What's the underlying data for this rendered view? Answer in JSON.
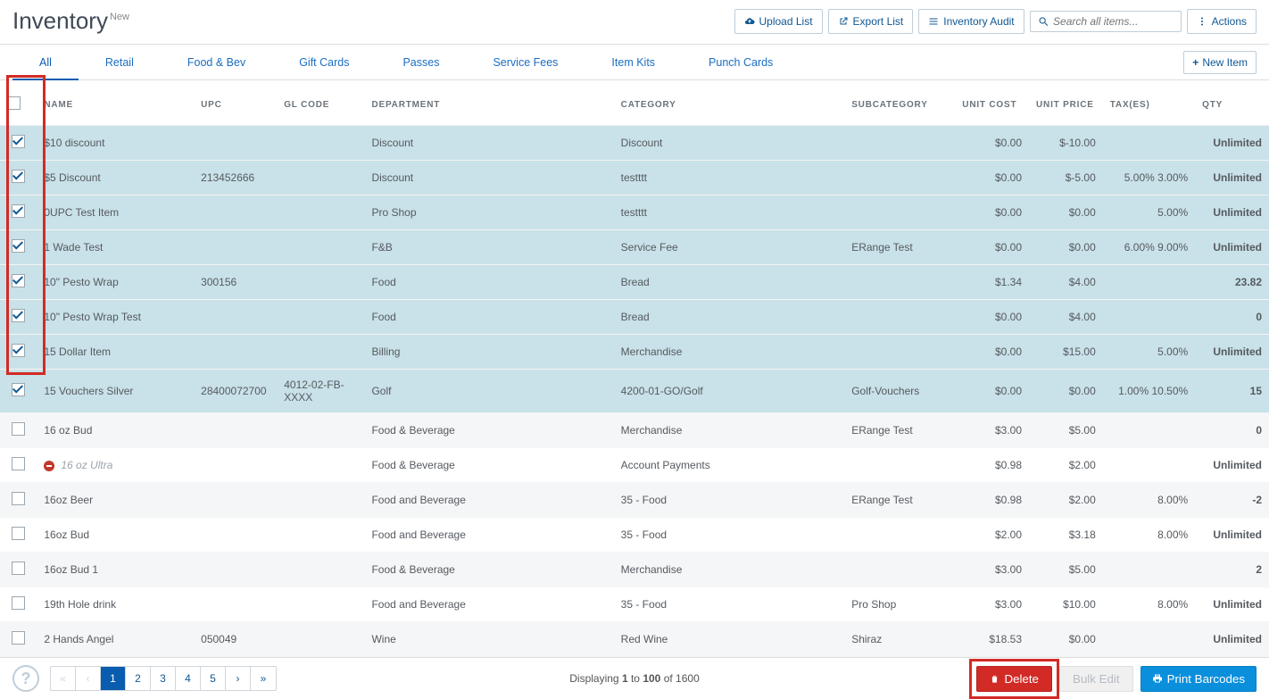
{
  "header": {
    "title": "Inventory",
    "badge": "New",
    "upload": "Upload List",
    "export": "Export List",
    "audit": "Inventory Audit",
    "search_placeholder": "Search all items...",
    "actions": "Actions"
  },
  "tabs": [
    "All",
    "Retail",
    "Food & Bev",
    "Gift Cards",
    "Passes",
    "Service Fees",
    "Item Kits",
    "Punch Cards"
  ],
  "new_item": "New Item",
  "columns": {
    "name": "NAME",
    "upc": "UPC",
    "gl": "GL CODE",
    "dept": "DEPARTMENT",
    "cat": "CATEGORY",
    "subcat": "SUBCATEGORY",
    "cost": "UNIT COST",
    "price": "UNIT PRICE",
    "tax": "TAX(ES)",
    "qty": "QTY"
  },
  "rows": [
    {
      "checked": true,
      "name": "$10 discount",
      "upc": "",
      "gl": "",
      "dept": "Discount",
      "cat": "Discount",
      "subcat": "",
      "cost": "$0.00",
      "price": "$-10.00",
      "tax": "",
      "qty": "Unlimited"
    },
    {
      "checked": true,
      "name": "$5 Discount",
      "upc": "213452666",
      "gl": "",
      "dept": "Discount",
      "cat": "testttt",
      "subcat": "",
      "cost": "$0.00",
      "price": "$-5.00",
      "tax": "5.00% 3.00%",
      "qty": "Unlimited"
    },
    {
      "checked": true,
      "name": "0UPC Test Item",
      "upc": "",
      "gl": "",
      "dept": "Pro Shop",
      "cat": "testttt",
      "subcat": "",
      "cost": "$0.00",
      "price": "$0.00",
      "tax": "5.00%",
      "qty": "Unlimited"
    },
    {
      "checked": true,
      "name": "1 Wade Test",
      "upc": "",
      "gl": "",
      "dept": "F&B",
      "cat": "Service Fee",
      "subcat": "ERange Test",
      "cost": "$0.00",
      "price": "$0.00",
      "tax": "6.00% 9.00%",
      "qty": "Unlimited"
    },
    {
      "checked": true,
      "name": "10\" Pesto Wrap",
      "upc": "300156",
      "gl": "",
      "dept": "Food",
      "cat": "Bread",
      "subcat": "",
      "cost": "$1.34",
      "price": "$4.00",
      "tax": "",
      "qty": "23.82"
    },
    {
      "checked": true,
      "name": "10\" Pesto Wrap Test",
      "upc": "",
      "gl": "",
      "dept": "Food",
      "cat": "Bread",
      "subcat": "",
      "cost": "$0.00",
      "price": "$4.00",
      "tax": "",
      "qty": "0"
    },
    {
      "checked": true,
      "name": "15 Dollar Item",
      "upc": "",
      "gl": "",
      "dept": "Billing",
      "cat": "Merchandise",
      "subcat": "",
      "cost": "$0.00",
      "price": "$15.00",
      "tax": "5.00%",
      "qty": "Unlimited"
    },
    {
      "checked": true,
      "name": "15 Vouchers Silver",
      "upc": "28400072700",
      "gl": "4012-02-FB-XXXX",
      "dept": "Golf",
      "cat": "4200-01-GO/Golf",
      "subcat": "Golf-Vouchers",
      "cost": "$0.00",
      "price": "$0.00",
      "tax": "1.00% 10.50%",
      "qty": "15"
    },
    {
      "checked": false,
      "alt": true,
      "name": "16 oz Bud",
      "upc": "",
      "gl": "",
      "dept": "Food & Beverage",
      "cat": "Merchandise",
      "subcat": "ERange Test",
      "cost": "$3.00",
      "price": "$5.00",
      "tax": "",
      "qty": "0"
    },
    {
      "checked": false,
      "inactive": true,
      "name": "16 oz Ultra",
      "upc": "",
      "gl": "",
      "dept": "Food & Beverage",
      "cat": "Account Payments",
      "subcat": "",
      "cost": "$0.98",
      "price": "$2.00",
      "tax": "",
      "qty": "Unlimited"
    },
    {
      "checked": false,
      "alt": true,
      "name": "16oz Beer",
      "upc": "",
      "gl": "",
      "dept": "Food and Beverage",
      "cat": "35 - Food",
      "subcat": "ERange Test",
      "cost": "$0.98",
      "price": "$2.00",
      "tax": "8.00%",
      "qty": "-2"
    },
    {
      "checked": false,
      "name": "16oz Bud",
      "upc": "",
      "gl": "",
      "dept": "Food and Beverage",
      "cat": "35 - Food",
      "subcat": "",
      "cost": "$2.00",
      "price": "$3.18",
      "tax": "8.00%",
      "qty": "Unlimited"
    },
    {
      "checked": false,
      "alt": true,
      "name": "16oz Bud 1",
      "upc": "",
      "gl": "",
      "dept": "Food & Beverage",
      "cat": "Merchandise",
      "subcat": "",
      "cost": "$3.00",
      "price": "$5.00",
      "tax": "",
      "qty": "2"
    },
    {
      "checked": false,
      "name": "19th Hole drink",
      "upc": "",
      "gl": "",
      "dept": "Food and Beverage",
      "cat": "35 - Food",
      "subcat": "Pro Shop",
      "cost": "$3.00",
      "price": "$10.00",
      "tax": "8.00%",
      "qty": "Unlimited"
    },
    {
      "checked": false,
      "alt": true,
      "name": "2 Hands Angel",
      "upc": "050049",
      "gl": "",
      "dept": "Wine",
      "cat": "Red Wine",
      "subcat": "Shiraz",
      "cost": "$18.53",
      "price": "$0.00",
      "tax": "",
      "qty": "Unlimited"
    }
  ],
  "pager": {
    "display_prefix": "Displaying ",
    "from": "1",
    "to": "100",
    "of": "1600",
    "to_word": " to ",
    "of_word": " of "
  },
  "footer": {
    "delete": "Delete",
    "bulk": "Bulk Edit",
    "print": "Print Barcodes"
  }
}
